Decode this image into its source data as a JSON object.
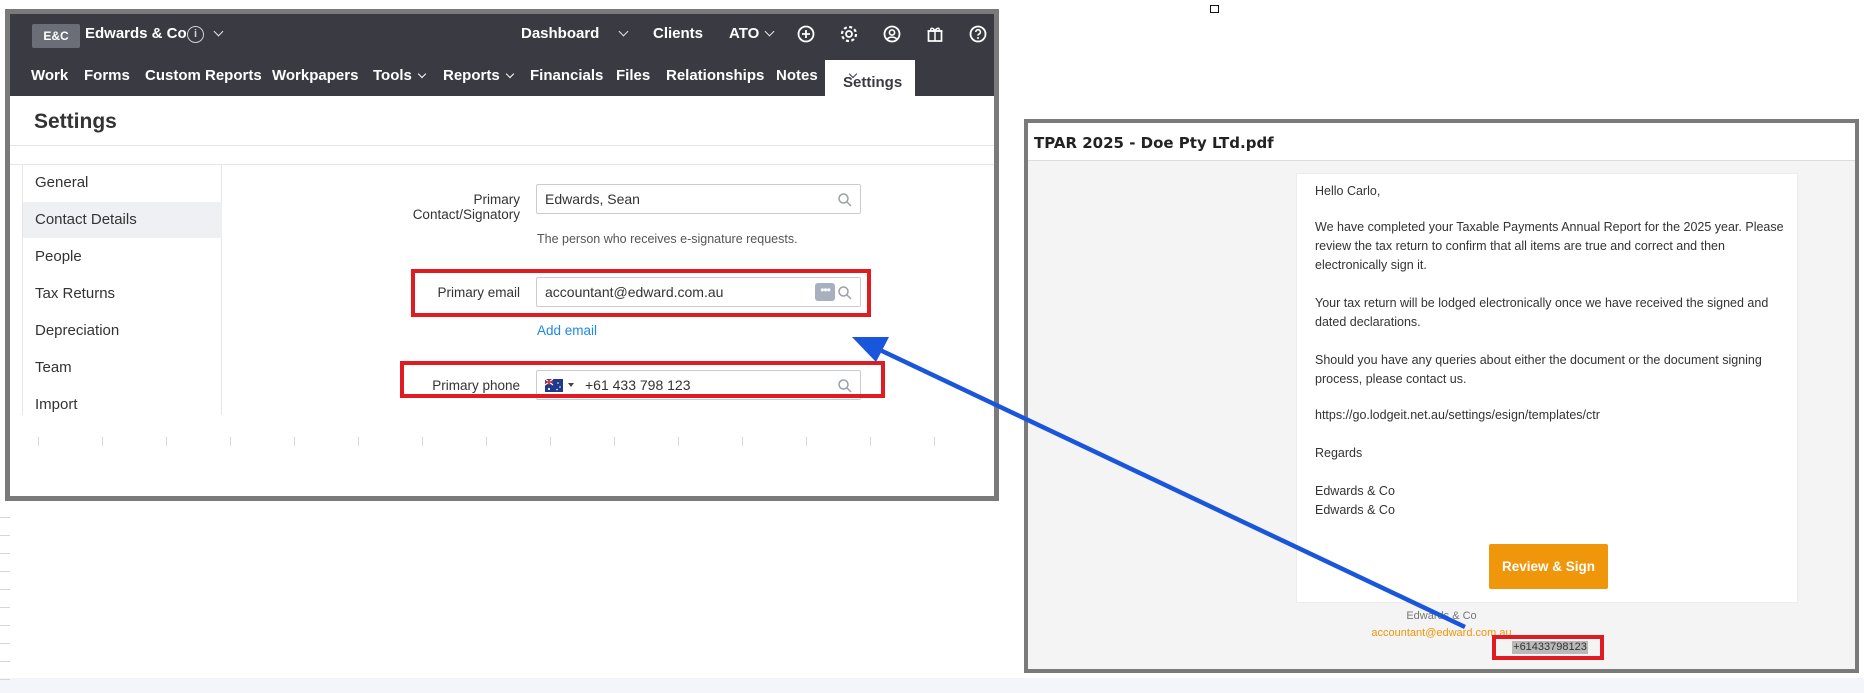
{
  "app": {
    "logo": "E&C",
    "firm_name": "Edwards & Co",
    "info_glyph": "i",
    "top_links": {
      "dashboard": "Dashboard",
      "clients": "Clients",
      "ato": "ATO"
    },
    "top_icons": [
      "add-circle-icon",
      "gear-icon",
      "user-circle-icon",
      "gift-icon",
      "help-icon"
    ],
    "nav": {
      "work": "Work",
      "forms": "Forms",
      "custom_reports": "Custom Reports",
      "workpapers": "Workpapers",
      "tools": "Tools",
      "reports": "Reports",
      "financials": "Financials",
      "files": "Files",
      "relationships": "Relationships",
      "notes": "Notes",
      "settings": "Settings"
    },
    "page_title": "Settings",
    "sidebar": {
      "items": [
        {
          "label": "General"
        },
        {
          "label": "Contact Details"
        },
        {
          "label": "People"
        },
        {
          "label": "Tax Returns"
        },
        {
          "label": "Depreciation"
        },
        {
          "label": "Team"
        },
        {
          "label": "Import"
        }
      ],
      "active": "Contact Details"
    },
    "contact": {
      "signatory_label_1": "Primary",
      "signatory_label_2": "Contact/Signatory",
      "signatory_value": "Edwards, Sean",
      "signatory_hint": "The person who receives e-signature requests.",
      "email_label": "Primary email",
      "email_value": "accountant@edward.com.au",
      "dots_glyph": "•••",
      "add_email": "Add email",
      "phone_label": "Primary phone",
      "phone_value": "+61 433 798 123"
    },
    "colors": {
      "topbar": "#3a3b42",
      "link": "#1e88e5",
      "highlight": "#e11b22"
    }
  },
  "email": {
    "title": "TPAR 2025 - Doe Pty LTd.pdf",
    "greeting": "Hello Carlo,",
    "para1": "We have completed your Taxable Payments Annual Report for the 2025 year. Please review the tax return to confirm that all items are true and correct and then electronically sign it.",
    "para2": "Your tax return will be lodged electronically once we have received the signed and dated declarations.",
    "para3": "Should you have any queries about either the document or the document signing process, please contact us.",
    "link": "https://go.lodgeit.net.au/settings/esign/templates/ctr",
    "regards": "Regards",
    "sig1": "Edwards & Co",
    "sig2": "Edwards & Co",
    "button": "Review & Sign",
    "footer_name": "Edwards & Co",
    "footer_email": "accountant@edward.com.au",
    "footer_phone": "+61433798123",
    "colors": {
      "button": "#f0960a",
      "arrow": "#1a56db"
    }
  }
}
